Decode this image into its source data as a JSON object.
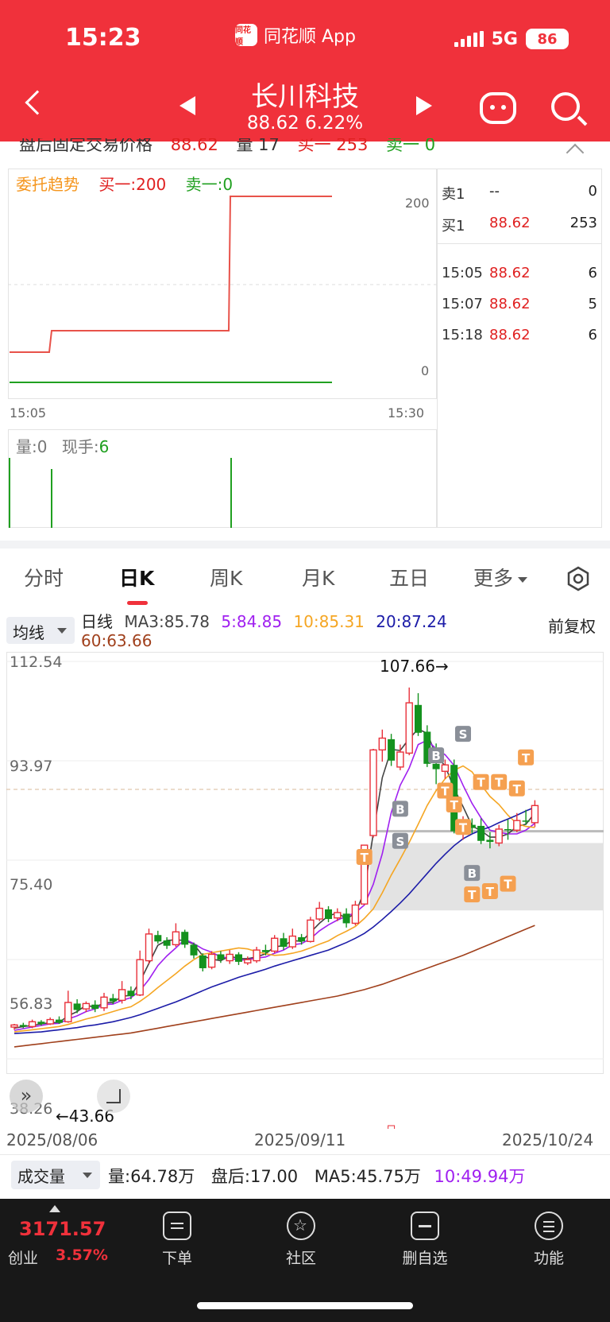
{
  "status_bar": {
    "time": "15:23",
    "app_name": "同花顺 App",
    "logo_text": "同花顺",
    "network": "5G",
    "battery": "86"
  },
  "header": {
    "stock_name": "长川科技",
    "price_change": "88.62 6.22%"
  },
  "clipped_row": {
    "label": "盘后固定交易价格",
    "price": "88.62",
    "vol": "量 17",
    "buy": "买一 253",
    "sell": "卖一 0"
  },
  "order_trend": {
    "title": "委托趋势",
    "buy": "买一:200",
    "sell": "卖一:0",
    "y_top": "200",
    "y_bottom": "0",
    "x_start": "15:05",
    "x_end": "15:30",
    "volume_label": "量:0",
    "current_label": "现手:",
    "current_value": "6"
  },
  "order_book": {
    "sell1": {
      "label": "卖1",
      "price": "--",
      "qty": "0"
    },
    "buy1": {
      "label": "买1",
      "price": "88.62",
      "qty": "253"
    },
    "trades": [
      {
        "time": "15:05",
        "price": "88.62",
        "qty": "6"
      },
      {
        "time": "15:07",
        "price": "88.62",
        "qty": "5"
      },
      {
        "time": "15:18",
        "price": "88.62",
        "qty": "6"
      }
    ]
  },
  "tabs": [
    "分时",
    "日K",
    "周K",
    "月K",
    "五日",
    "更多"
  ],
  "ma": {
    "button": "均线",
    "name": "日线",
    "ma3": "MA3:85.78",
    "ma5": "5:84.85",
    "ma10": "10:85.31",
    "ma20": "20:87.24",
    "ma60": "60:63.66",
    "adjust": "前复权",
    "colors": {
      "ma3": "#444444",
      "ma5": "#a020f0",
      "ma10": "#f5a623",
      "ma20": "#1c1ca8",
      "ma60": "#a0401c"
    }
  },
  "kline": {
    "y_labels": [
      "112.54",
      "93.97",
      "75.40",
      "56.83",
      "38.26"
    ],
    "high_marker": "107.66→",
    "low_marker": "←43.66",
    "x_labels": [
      "2025/08/06",
      "2025/09/11",
      "2025/10/24"
    ]
  },
  "chart_data": {
    "type": "candlestick",
    "ylim": [
      38.26,
      112.54
    ],
    "y_ticks": [
      112.54,
      93.97,
      75.4,
      56.83,
      38.26
    ],
    "x_ticks": [
      "2025/08/06",
      "2025/09/11",
      "2025/10/24"
    ],
    "candles": [
      [
        44.2,
        44.6,
        43.7,
        44.8
      ],
      [
        44.6,
        44.3,
        44.0,
        45.0
      ],
      [
        44.3,
        45.2,
        44.0,
        45.6
      ],
      [
        45.2,
        44.8,
        44.5,
        45.5
      ],
      [
        44.8,
        45.6,
        44.6,
        46.0
      ],
      [
        45.6,
        45.0,
        44.8,
        46.2
      ],
      [
        45.2,
        48.8,
        45.0,
        51.0
      ],
      [
        48.6,
        47.4,
        46.8,
        49.4
      ],
      [
        47.6,
        48.6,
        47.0,
        49.0
      ],
      [
        48.4,
        47.6,
        47.0,
        49.2
      ],
      [
        47.8,
        49.8,
        47.2,
        50.6
      ],
      [
        49.6,
        49.0,
        48.5,
        50.4
      ],
      [
        49.2,
        51.2,
        48.6,
        52.8
      ],
      [
        51.0,
        50.0,
        49.4,
        51.8
      ],
      [
        50.2,
        56.8,
        50.0,
        58.5
      ],
      [
        56.6,
        61.6,
        56.0,
        62.6
      ],
      [
        61.4,
        60.2,
        59.8,
        62.2
      ],
      [
        60.4,
        59.4,
        58.8,
        61.0
      ],
      [
        59.6,
        62.0,
        59.2,
        63.6
      ],
      [
        62.0,
        59.6,
        59.0,
        62.4
      ],
      [
        59.6,
        57.6,
        57.0,
        60.0
      ],
      [
        57.6,
        55.2,
        54.6,
        58.0
      ],
      [
        55.4,
        57.8,
        55.0,
        58.4
      ],
      [
        57.8,
        56.8,
        56.2,
        58.4
      ],
      [
        56.6,
        57.8,
        56.0,
        58.6
      ],
      [
        57.8,
        56.4,
        55.8,
        58.2
      ],
      [
        56.2,
        56.8,
        55.8,
        57.4
      ],
      [
        56.6,
        58.6,
        56.2,
        59.2
      ],
      [
        58.6,
        58.2,
        57.6,
        59.6
      ],
      [
        58.4,
        60.8,
        58.0,
        61.4
      ],
      [
        60.8,
        59.2,
        58.6,
        61.8
      ],
      [
        59.2,
        61.2,
        58.8,
        62.6
      ],
      [
        61.0,
        60.2,
        59.6,
        61.6
      ],
      [
        60.2,
        64.2,
        60.0,
        64.8
      ],
      [
        64.4,
        66.4,
        64.0,
        67.6
      ],
      [
        66.2,
        64.4,
        63.8,
        66.8
      ],
      [
        64.6,
        65.6,
        64.0,
        66.4
      ],
      [
        65.4,
        63.6,
        62.8,
        66.4
      ],
      [
        63.6,
        67.0,
        63.2,
        67.8
      ],
      [
        67.2,
        78.2,
        67.0,
        78.2
      ],
      [
        80.0,
        96.0,
        79.6,
        96.2
      ],
      [
        96.0,
        98.2,
        93.8,
        99.8
      ],
      [
        98.0,
        94.0,
        93.0,
        99.0
      ],
      [
        92.8,
        95.6,
        92.2,
        97.0
      ],
      [
        95.4,
        104.8,
        95.0,
        107.66
      ],
      [
        104.4,
        99.2,
        98.6,
        106.6
      ],
      [
        99.4,
        93.4,
        92.8,
        100.6
      ],
      [
        93.4,
        92.4,
        89.6,
        97.2
      ],
      [
        92.0,
        93.2,
        90.6,
        94.2
      ],
      [
        93.2,
        80.8,
        80.4,
        94.2
      ],
      [
        80.8,
        82.2,
        79.2,
        83.6
      ],
      [
        82.0,
        81.4,
        80.4,
        83.2
      ],
      [
        81.8,
        79.0,
        78.4,
        83.2
      ],
      [
        79.2,
        78.8,
        77.6,
        80.6
      ],
      [
        78.6,
        81.2,
        78.0,
        82.0
      ],
      [
        81.2,
        81.0,
        79.2,
        83.0
      ],
      [
        81.0,
        82.8,
        80.6,
        84.2
      ],
      [
        82.8,
        82.6,
        82.0,
        84.8
      ],
      [
        82.4,
        85.6,
        81.6,
        86.6
      ]
    ],
    "ma": {
      "ma3": [
        44.0,
        44.3,
        44.5,
        44.8,
        45.0,
        45.1,
        46.3,
        47.1,
        48.3,
        47.9,
        48.7,
        48.8,
        50.0,
        50.1,
        52.7,
        56.1,
        59.5,
        60.4,
        60.5,
        60.4,
        59.7,
        57.5,
        56.9,
        56.6,
        57.5,
        57.0,
        57.0,
        57.3,
        57.9,
        59.2,
        59.4,
        60.4,
        60.2,
        61.9,
        63.6,
        65.0,
        65.5,
        64.5,
        65.4,
        69.6,
        80.4,
        90.8,
        96.1,
        95.9,
        98.1,
        99.9,
        99.1,
        95.0,
        93.0,
        88.8,
        85.4,
        81.8,
        80.9,
        79.7,
        79.7,
        80.3,
        81.7,
        82.1,
        84.2
      ],
      "ma5": [
        43.6,
        43.9,
        44.2,
        44.5,
        44.8,
        44.9,
        45.7,
        46.3,
        47.1,
        47.6,
        48.4,
        48.5,
        49.2,
        49.7,
        51.0,
        53.1,
        55.7,
        57.5,
        59.0,
        60.6,
        59.8,
        58.8,
        58.2,
        57.3,
        57.1,
        56.7,
        56.8,
        57.1,
        57.3,
        58.0,
        58.6,
        59.6,
        59.8,
        60.7,
        62.2,
        63.3,
        64.2,
        64.9,
        65.6,
        67.0,
        70.9,
        76.6,
        84.3,
        89.4,
        92.6,
        97.0,
        97.8,
        96.2,
        95.1,
        93.1,
        89.4,
        86.0,
        83.3,
        81.0,
        80.6,
        80.3,
        80.3,
        81.0,
        82.3
      ],
      "ma10": [
        43.3,
        43.5,
        43.7,
        43.9,
        44.1,
        44.3,
        44.7,
        45.2,
        45.7,
        46.1,
        46.6,
        47.1,
        47.6,
        48.0,
        49.0,
        50.2,
        51.6,
        52.9,
        54.2,
        55.6,
        56.8,
        57.8,
        58.1,
        58.4,
        58.7,
        59.0,
        58.8,
        58.3,
        57.9,
        57.6,
        57.7,
        58.0,
        58.4,
        59.0,
        59.7,
        60.3,
        61.3,
        62.1,
        63.0,
        64.5,
        66.3,
        69.3,
        72.6,
        75.6,
        78.7,
        82.1,
        85.6,
        88.4,
        90.6,
        92.2,
        93.0,
        91.9,
        89.5,
        87.3,
        85.8,
        83.8,
        82.2,
        81.7,
        81.5
      ],
      "ma20": [
        43.0,
        43.1,
        43.2,
        43.3,
        43.5,
        43.7,
        43.9,
        44.1,
        44.4,
        44.6,
        44.9,
        45.2,
        45.6,
        46.0,
        46.5,
        47.1,
        47.7,
        48.3,
        48.9,
        49.6,
        50.3,
        51.0,
        51.7,
        52.3,
        52.9,
        53.5,
        54.0,
        54.5,
        55.0,
        55.6,
        56.1,
        56.6,
        57.1,
        57.6,
        58.1,
        58.6,
        59.3,
        60.0,
        60.8,
        61.7,
        62.9,
        64.3,
        65.8,
        67.4,
        69.1,
        71.0,
        72.9,
        74.8,
        76.5,
        78.1,
        79.4,
        80.3,
        81.0,
        81.6,
        82.4,
        83.1,
        83.8,
        84.6,
        85.3
      ],
      "ma60": [
        40.5,
        40.7,
        40.9,
        41.1,
        41.3,
        41.5,
        41.7,
        41.9,
        42.1,
        42.3,
        42.5,
        42.7,
        42.9,
        43.1,
        43.4,
        43.7,
        44.0,
        44.3,
        44.6,
        44.9,
        45.2,
        45.5,
        45.8,
        46.1,
        46.4,
        46.7,
        47.0,
        47.3,
        47.6,
        47.9,
        48.2,
        48.5,
        48.8,
        49.1,
        49.4,
        49.7,
        50.0,
        50.4,
        50.8,
        51.2,
        51.7,
        52.2,
        52.8,
        53.4,
        54.0,
        54.6,
        55.2,
        55.8,
        56.4,
        57.0,
        57.6,
        58.3,
        59.0,
        59.7,
        60.4,
        61.1,
        61.8,
        62.5,
        63.2
      ]
    },
    "reference_line": 88.62,
    "markers": {
      "B": [
        [
          43,
          85.0
        ],
        [
          47,
          95.0
        ],
        [
          51,
          73.0
        ]
      ],
      "S": [
        [
          43,
          79.0
        ],
        [
          50,
          99.0
        ]
      ],
      "T": [
        [
          39,
          76.0
        ],
        [
          48,
          88.4
        ],
        [
          49,
          85.8
        ],
        [
          50,
          81.6
        ],
        [
          51,
          69.0
        ],
        [
          52,
          90.0
        ],
        [
          53,
          69.6
        ],
        [
          54,
          90.0
        ],
        [
          55,
          71.0
        ],
        [
          56,
          88.8
        ],
        [
          57,
          94.6
        ]
      ]
    }
  },
  "volume": {
    "selector": "成交量",
    "vol": "量:64.78万",
    "after": "盘后:17.00",
    "ma5": "MA5:45.75万",
    "ma10": "10:49.94万"
  },
  "bottom_nav": {
    "index_value": "3171.57",
    "index_name": "创业",
    "index_change": "3.57%",
    "items": [
      "下单",
      "社区",
      "删自选",
      "功能"
    ]
  }
}
